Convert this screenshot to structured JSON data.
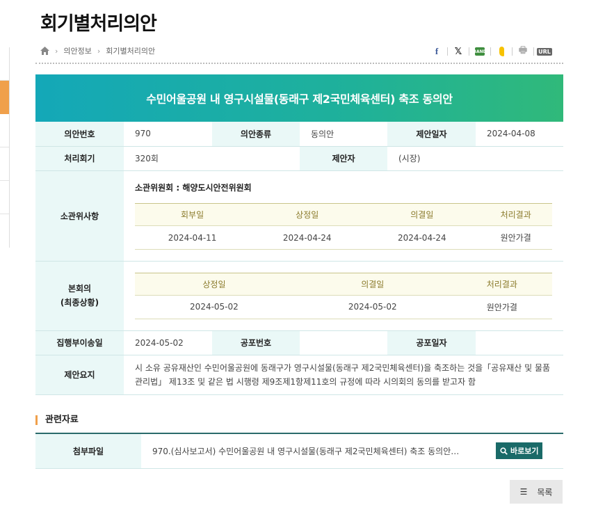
{
  "page": {
    "title": "회기별처리의안"
  },
  "breadcrumb": {
    "items": [
      "의안정보",
      "회기별처리의안"
    ]
  },
  "share": {
    "facebook": "f",
    "x": "𝕏",
    "band": "BAND",
    "url": "URL"
  },
  "bill": {
    "title": "수민어울공원 내 영구시설물(동래구 제2국민체육센터) 축조 동의안",
    "labels": {
      "number": "의안번호",
      "type": "의안종류",
      "proposal_date": "제안일자",
      "session": "처리회기",
      "proposer": "제안자",
      "committee": "소관위사항",
      "plenary": "본회의\n(최종상황)",
      "transfer_date": "집행부이송일",
      "promulgation_no": "공포번호",
      "promulgation_date": "공포일자",
      "summary": "제안요지"
    },
    "number": "970",
    "type": "동의안",
    "proposal_date": "2024-04-08",
    "session": "320회",
    "proposer": "(시장)",
    "committee": {
      "name": "소관위원회 : 해양도시안전위원회",
      "headers": [
        "회부일",
        "상정일",
        "의결일",
        "처리결과"
      ],
      "values": [
        "2024-04-11",
        "2024-04-24",
        "2024-04-24",
        "원안가결"
      ]
    },
    "plenary": {
      "label_line1": "본회의",
      "label_line2": "(최종상황)",
      "headers": [
        "상정일",
        "의결일",
        "처리결과"
      ],
      "values": [
        "2024-05-02",
        "2024-05-02",
        "원안가결"
      ]
    },
    "transfer_date": "2024-05-02",
    "promulgation_no": "",
    "promulgation_date": "",
    "summary": "시 소유 공유재산인 수민어울공원에 동래구가 영구시설물(동래구 제2국민체육센터)을 축조하는 것을「공유재산 및 물품 관리법」 제13조 및 같은 법 시행령 제9조제1항제11호의 규정에 따라 시의회의 동의를 받고자 함"
  },
  "related": {
    "title": "관련자료",
    "attach_label": "첨부파일",
    "file_name": "970.(심사보고서) 수민어울공원 내 영구시설물(동래구 제2국민체육센터) 축조 동의안…",
    "view_button": "바로보기"
  },
  "list_button": {
    "icon": "☰",
    "label": "목록"
  },
  "colors": {
    "accent": "#f0a04b",
    "header_start": "#14a8b8",
    "header_end": "#30b97a",
    "button": "#1a6a68"
  }
}
